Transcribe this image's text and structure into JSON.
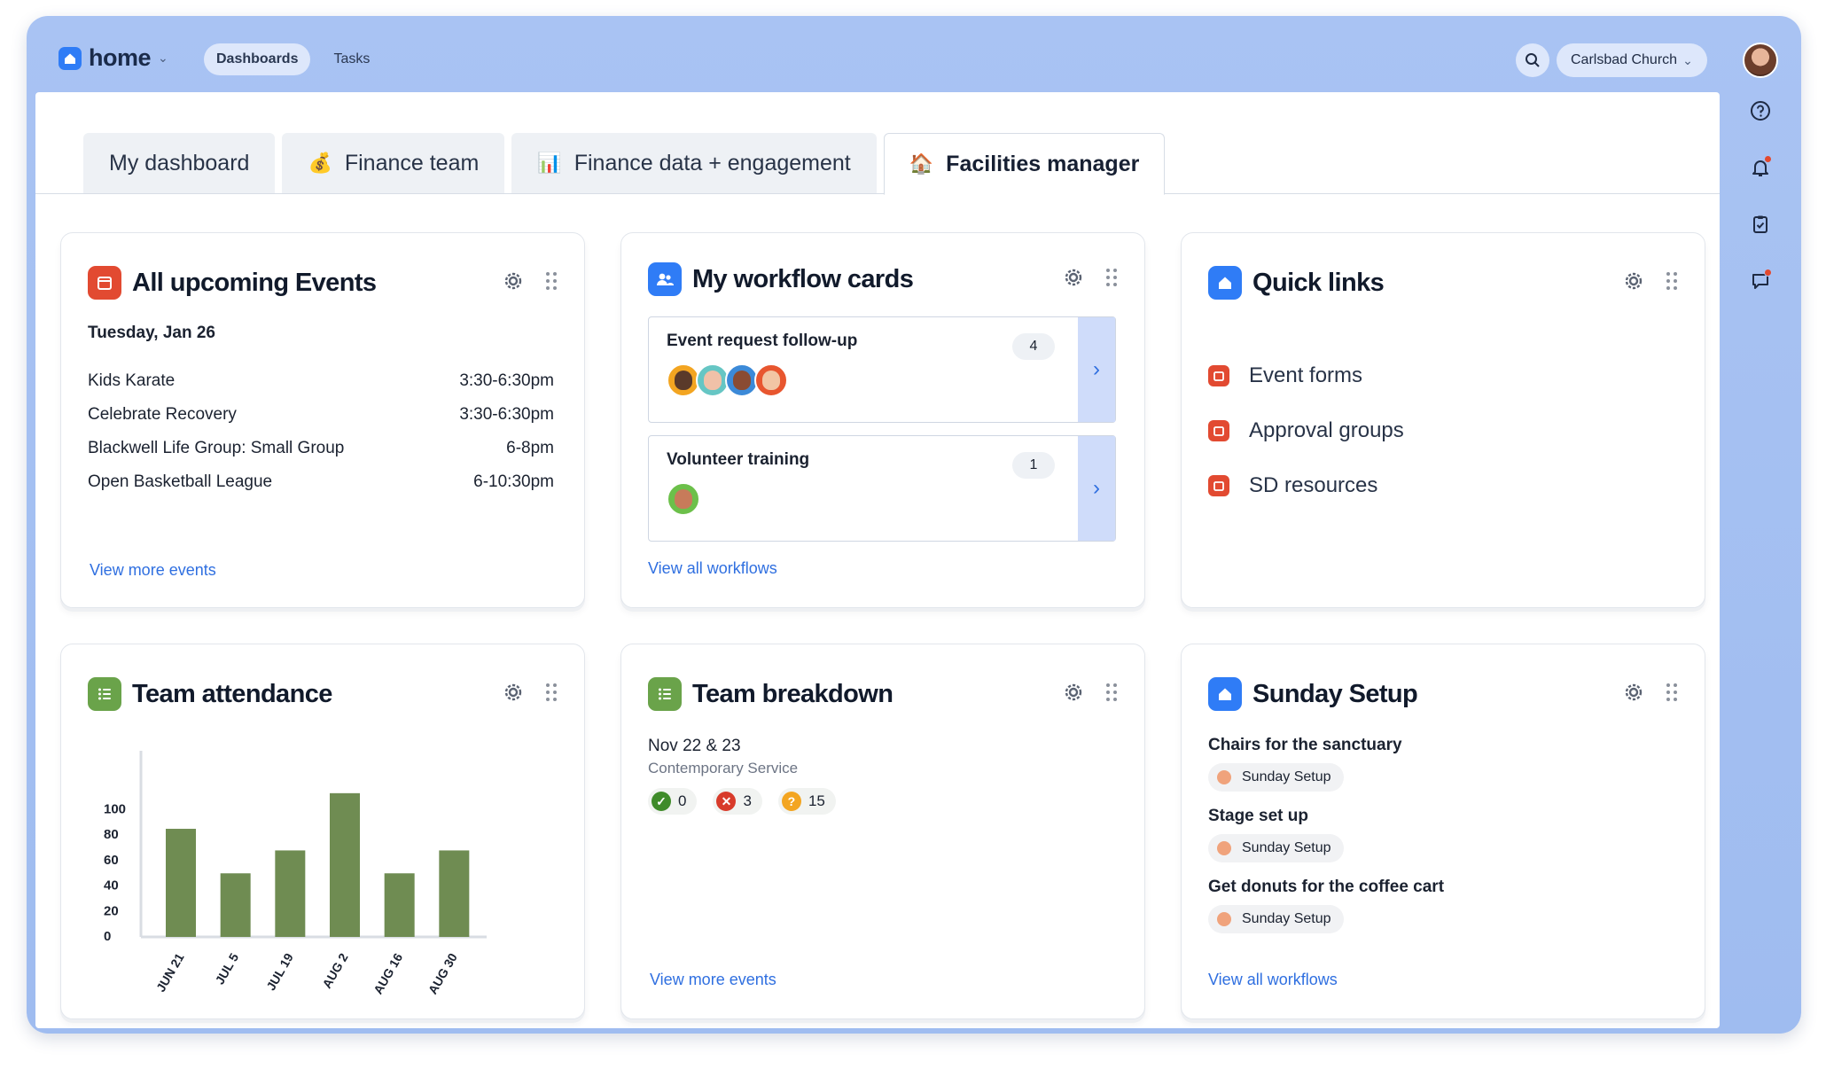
{
  "topbar": {
    "logo_text": "home",
    "nav": [
      "Dashboards",
      "Tasks"
    ],
    "org_name": "Carlsbad Church"
  },
  "tabs": [
    {
      "label": "My dashboard",
      "icon": ""
    },
    {
      "label": "Finance team",
      "icon": "💰"
    },
    {
      "label": "Finance data + engagement",
      "icon": "📊"
    },
    {
      "label": "Facilities manager",
      "icon": "🏠"
    }
  ],
  "colors": {
    "accent": "#2f7cf6",
    "red": "#e24a31",
    "green": "#6aa34a",
    "bar": "#6f8c52"
  },
  "events_card": {
    "title": "All upcoming Events",
    "date": "Tuesday, Jan 26",
    "rows": [
      {
        "name": "Kids Karate",
        "time": "3:30-6:30pm"
      },
      {
        "name": "Celebrate Recovery",
        "time": "3:30-6:30pm"
      },
      {
        "name": "Blackwell Life Group: Small Group",
        "time": "6-8pm"
      },
      {
        "name": "Open Basketball League",
        "time": "6-10:30pm"
      }
    ],
    "link": "View more events"
  },
  "workflow_card": {
    "title": "My workflow cards",
    "items": [
      {
        "title": "Event request follow-up",
        "count": "4"
      },
      {
        "title": "Volunteer training",
        "count": "1"
      }
    ],
    "link": "View all workflows"
  },
  "quick_links": {
    "title": "Quick links",
    "items": [
      "Event forms",
      "Approval groups",
      "SD resources"
    ]
  },
  "attendance": {
    "title": "Team attendance"
  },
  "chart_data": {
    "type": "bar",
    "categories": [
      "JUN 21",
      "JUL 5",
      "JUL 19",
      "AUG 2",
      "AUG 16",
      "AUG 30"
    ],
    "values": [
      85,
      50,
      68,
      113,
      50,
      68
    ],
    "yticks": [
      0,
      20,
      40,
      60,
      80,
      100
    ],
    "ylim": [
      0,
      120
    ],
    "title": "",
    "xlabel": "",
    "ylabel": "",
    "grid": false
  },
  "breakdown": {
    "title": "Team breakdown",
    "date": "Nov 22 & 23",
    "service": "Contemporary Service",
    "badges": [
      {
        "type": "confirmed",
        "count": "0"
      },
      {
        "type": "declined",
        "count": "3"
      },
      {
        "type": "unconfirmed",
        "count": "15"
      }
    ],
    "link": "View more events"
  },
  "sunday": {
    "title": "Sunday Setup",
    "items": [
      {
        "title": "Chairs for the sanctuary",
        "tag": "Sunday Setup"
      },
      {
        "title": "Stage set up",
        "tag": "Sunday Setup"
      },
      {
        "title": "Get donuts for the coffee cart",
        "tag": "Sunday Setup"
      }
    ],
    "link": "View all workflows"
  }
}
